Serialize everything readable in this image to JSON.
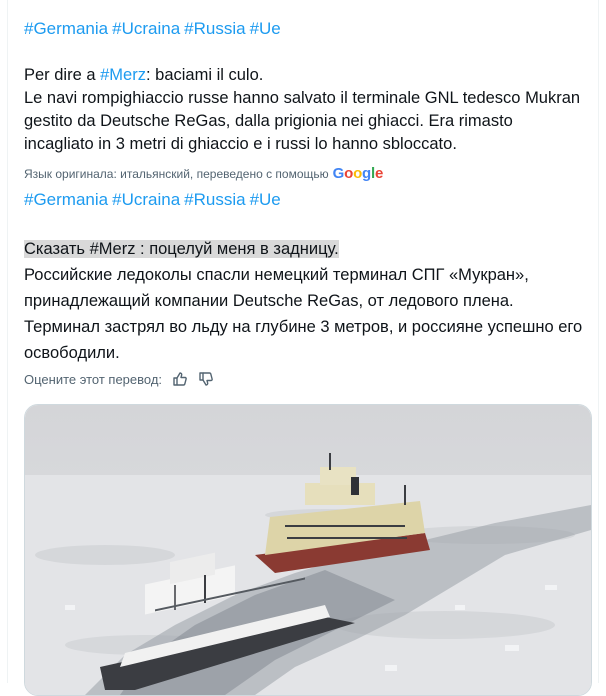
{
  "hashtags_top": [
    "#Germania",
    "#Ucraina",
    "#Russia",
    "#Ue"
  ],
  "post": {
    "line1_prefix": "Per dire a ",
    "line1_mention": "#Merz",
    "line1_suffix": ": baciami il culo.",
    "body": "Le navi rompighiaccio russe hanno salvato il terminale GNL tedesco Mukran gestito da Deutsche ReGas, dalla prigionia nei ghiacci. Era rimasto incagliato in 3 metri di ghiaccio e i russi lo hanno sbloccato."
  },
  "translation_notice": {
    "text": "Язык оригинала: итальянский, переведено с помощью",
    "logo": "Google"
  },
  "hashtags_translated": [
    "#Germania",
    "#Ucraina",
    "#Russia",
    "#Ue"
  ],
  "translation": {
    "highlighted": "Сказать #Merz : поцелуй меня в задницу.",
    "body": "Российские ледоколы спасли немецкий терминал СПГ «Мукран», принадлежащий компании Deutsche ReGas, от ледового плена. Терминал застрял во льду на глубине 3 метров, и россияне успешно его освободили."
  },
  "rate": {
    "label": "Оцените этот перевод:",
    "thumbs_up_icon": "thumbs-up-icon",
    "thumbs_down_icon": "thumbs-down-icon"
  },
  "media": {
    "icon": "photo-icebreakers",
    "colors": {
      "sky": "#d8d9dc",
      "ice": "#e4e5e8",
      "water": "#8d949c",
      "hull_light": "#ddd4a8",
      "hull_red": "#8a3a32",
      "ship_dark": "#3b3d42"
    }
  }
}
